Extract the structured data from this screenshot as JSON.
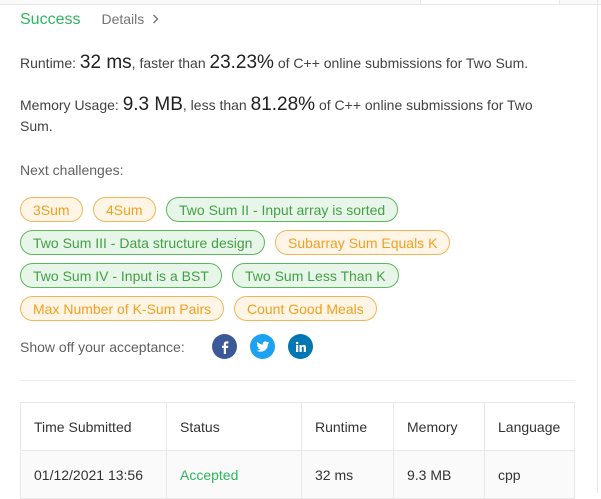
{
  "header": {
    "status": "Success",
    "details_label": "Details"
  },
  "runtime": {
    "label": "Runtime:",
    "value": "32 ms",
    "mid": ", faster than",
    "percent": "23.23%",
    "tail": "of C++ online submissions for Two Sum."
  },
  "memory": {
    "label": "Memory Usage:",
    "value": "9.3 MB",
    "mid": ", less than",
    "percent": "81.28%",
    "tail": "of C++ online submissions for Two Sum."
  },
  "next": {
    "label": "Next challenges:",
    "chips": [
      {
        "label": "3Sum",
        "difficulty": "medium"
      },
      {
        "label": "4Sum",
        "difficulty": "medium"
      },
      {
        "label": "Two Sum II - Input array is sorted",
        "difficulty": "easy"
      },
      {
        "label": "Two Sum III - Data structure design",
        "difficulty": "easy"
      },
      {
        "label": "Subarray Sum Equals K",
        "difficulty": "medium"
      },
      {
        "label": "Two Sum IV - Input is a BST",
        "difficulty": "easy"
      },
      {
        "label": "Two Sum Less Than K",
        "difficulty": "easy"
      },
      {
        "label": "Max Number of K-Sum Pairs",
        "difficulty": "medium"
      },
      {
        "label": "Count Good Meals",
        "difficulty": "medium"
      }
    ]
  },
  "share": {
    "label": "Show off your acceptance:",
    "networks": [
      {
        "icon": "facebook-icon",
        "color": "#3b5998"
      },
      {
        "icon": "twitter-icon",
        "color": "#1da1f2"
      },
      {
        "icon": "linkedin-icon",
        "color": "#0077b5"
      }
    ]
  },
  "table": {
    "headers": [
      "Time Submitted",
      "Status",
      "Runtime",
      "Memory",
      "Language"
    ],
    "rows": [
      [
        "01/12/2021 13:56",
        "Accepted",
        "32 ms",
        "9.3 MB",
        "cpp"
      ]
    ]
  },
  "colors": {
    "success": "#2db55d",
    "medium": "#f0a020",
    "easy": "#43a047"
  }
}
